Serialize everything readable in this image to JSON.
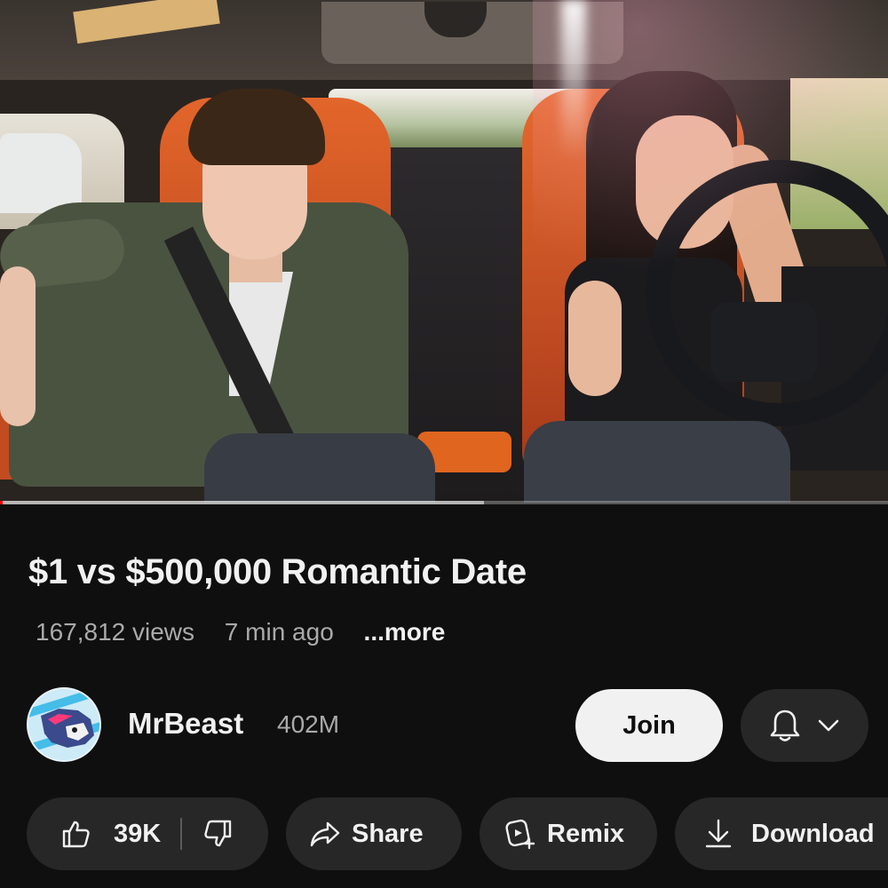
{
  "video": {
    "progress_played": 0.003,
    "progress_buffered": 0.545
  },
  "video_info": {
    "title": "$1 vs $500,000 Romantic Date",
    "views": "167,812 views",
    "posted": "7 min ago",
    "more_label": "...more"
  },
  "channel": {
    "name": "MrBeast",
    "subscribers": "402M",
    "join_label": "Join",
    "avatar_icon": "mrbeast-panther-logo",
    "notification_icon": "bell-icon"
  },
  "actions": {
    "like_count": "39K",
    "share_label": "Share",
    "remix_label": "Remix",
    "download_label": "Download"
  },
  "colors": {
    "background": "#0f0f0f",
    "pill": "#272727",
    "join_button": "#f1f1f1",
    "progress": "#ff0000"
  }
}
